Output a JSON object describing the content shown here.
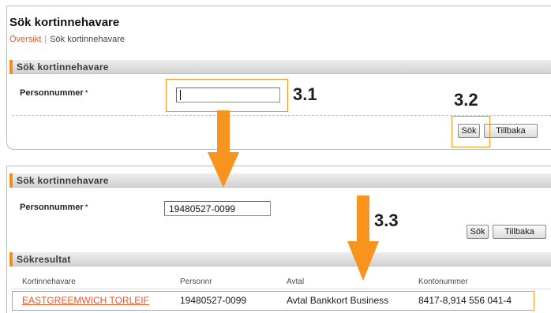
{
  "page": {
    "title": "Sök kortinnehavare"
  },
  "breadcrumb": {
    "items": [
      "Översikt",
      "Sök kortinnehavare"
    ],
    "separator": "|"
  },
  "search_panel": {
    "header": "Sök kortinnehavare",
    "field_label": "Personnummer",
    "required_marker": "*",
    "field_value": "",
    "buttons": {
      "search": "Sök",
      "back": "Tillbaka"
    }
  },
  "result_panel": {
    "header": "Sök kortinnehavare",
    "field_label": "Personnummer",
    "required_marker": "*",
    "field_value": "19480527-0099",
    "buttons": {
      "search": "Sök",
      "back": "Tillbaka"
    },
    "results_header": "Sökresultat",
    "columns": [
      "Kortinnehavare",
      "Personnr",
      "Avtal",
      "Kontonummer"
    ],
    "rows": [
      {
        "cardholder": "EASTGREEMWICH TORLEIF",
        "personnr": "19480527-0099",
        "agreement": "Avtal Bankkort Business",
        "account": "8417-8,914 556 041-4"
      }
    ]
  },
  "annotations": {
    "step_search_field": "3.1",
    "step_search_button": "3.2",
    "step_result": "3.3"
  },
  "icons": {
    "annotation_arrow": "arrow-down-icon"
  },
  "colors": {
    "annotation": "#f7941d",
    "link": "#e6582c",
    "section_accent": "#ef8c22"
  }
}
